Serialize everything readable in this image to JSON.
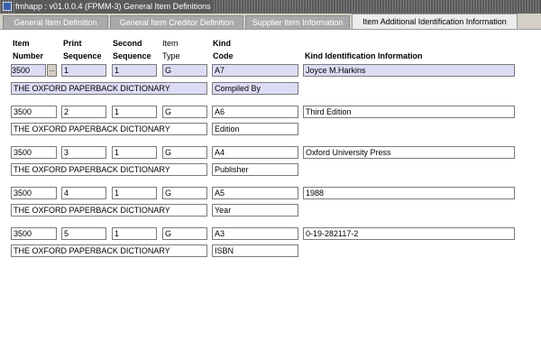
{
  "window": {
    "title": "fmhapp : v01.0.0.4 (FPMM-3) General Item Definitions"
  },
  "tabs": [
    {
      "label": "General Item Definition"
    },
    {
      "label": "General Item Creditor Definition"
    },
    {
      "label": "Supplier Item Information"
    },
    {
      "label": "Item Additional Identification Information"
    }
  ],
  "headers": {
    "item_number_1": "Item",
    "item_number_2": "Number",
    "print_seq_1": "Print",
    "print_seq_2": "Sequence",
    "second_seq_1": "Second",
    "second_seq_2": "Sequence",
    "item_type_1": "Item",
    "item_type_2": "Type",
    "kind_code_1": "Kind",
    "kind_code_2": "Code",
    "kind_info": "Kind Identification Information"
  },
  "lov_label": "...",
  "records": [
    {
      "item_number": "3500",
      "print_seq": "1",
      "second_seq": "1",
      "item_type": "G",
      "kind_code": "A7",
      "kind_info": "Joyce M.Harkins",
      "description": "THE OXFORD PAPERBACK DICTIONARY",
      "kind_desc": "Compiled By"
    },
    {
      "item_number": "3500",
      "print_seq": "2",
      "second_seq": "1",
      "item_type": "G",
      "kind_code": "A6",
      "kind_info": "Third Edition",
      "description": "THE OXFORD PAPERBACK DICTIONARY",
      "kind_desc": "Edition"
    },
    {
      "item_number": "3500",
      "print_seq": "3",
      "second_seq": "1",
      "item_type": "G",
      "kind_code": "A4",
      "kind_info": "Oxford University Press",
      "description": "THE OXFORD PAPERBACK DICTIONARY",
      "kind_desc": "Publisher"
    },
    {
      "item_number": "3500",
      "print_seq": "4",
      "second_seq": "1",
      "item_type": "G",
      "kind_code": "A5",
      "kind_info": "1988",
      "description": "THE OXFORD PAPERBACK DICTIONARY",
      "kind_desc": "Year"
    },
    {
      "item_number": "3500",
      "print_seq": "5",
      "second_seq": "1",
      "item_type": "G",
      "kind_code": "A3",
      "kind_info": "0-19-282117-2",
      "description": "THE OXFORD PAPERBACK DICTIONARY",
      "kind_desc": "ISBN"
    }
  ]
}
